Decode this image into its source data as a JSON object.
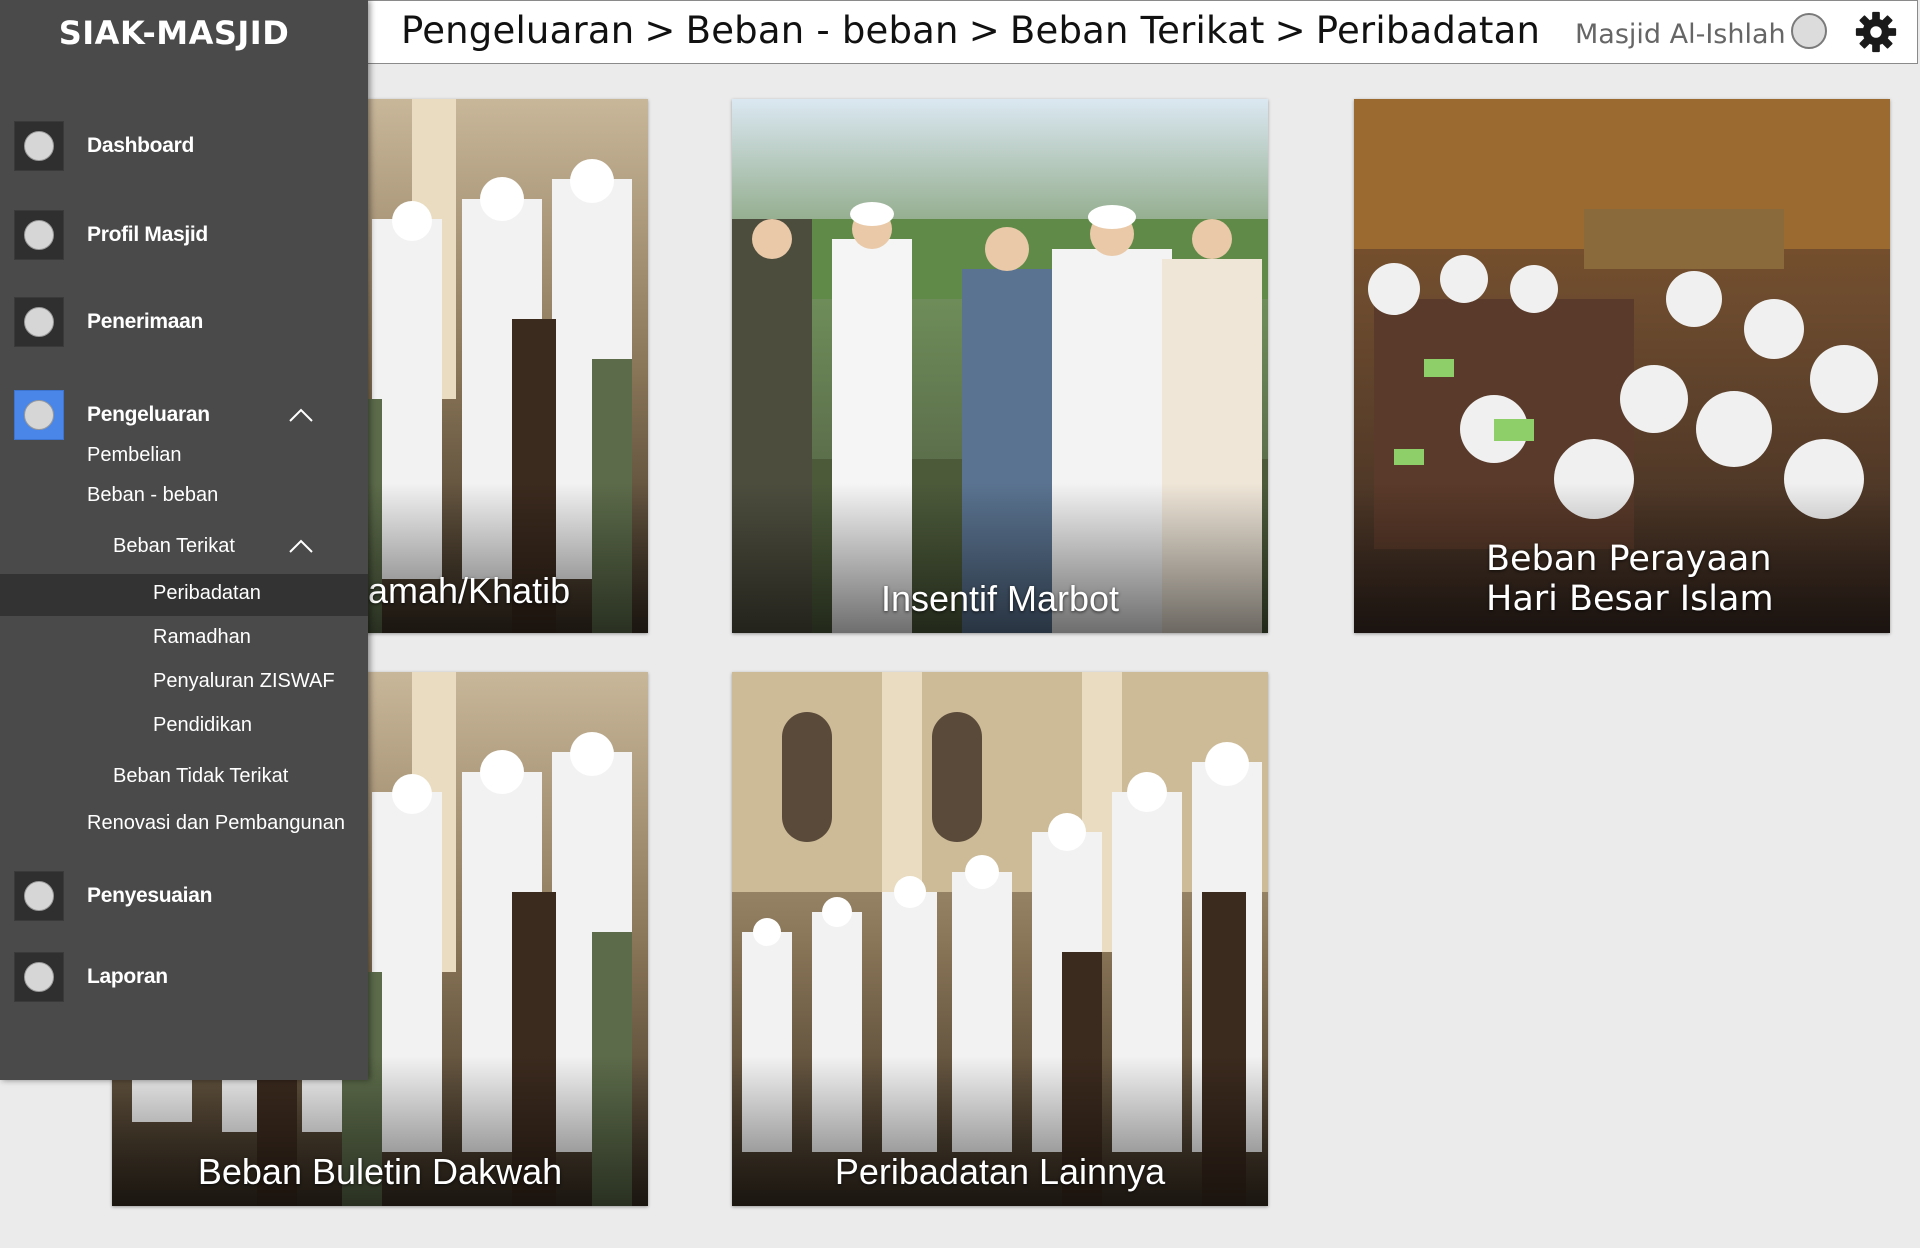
{
  "app": {
    "title": "SIAK-MASJID"
  },
  "header": {
    "breadcrumb": [
      "Pengeluaran",
      "Beban - beban",
      "Beban Terikat",
      "Peribadatan"
    ],
    "separator": ">",
    "mosque_name": "Masjid Al-Ishlah",
    "avatar_icon": "user-avatar-icon",
    "settings_icon": "gear-icon"
  },
  "sidebar": {
    "items": [
      {
        "label": "Dashboard",
        "icon": "circle-icon"
      },
      {
        "label": "Profil Masjid",
        "icon": "circle-icon"
      },
      {
        "label": "Penerimaan",
        "icon": "circle-icon"
      },
      {
        "label": "Pengeluaran",
        "icon": "circle-icon",
        "active": true,
        "expanded": true
      },
      {
        "label": "Penyesuaian",
        "icon": "circle-icon"
      },
      {
        "label": "Laporan",
        "icon": "circle-icon"
      }
    ],
    "pengeluaran_sub": {
      "pembelian": "Pembelian",
      "beban": "Beban - beban",
      "beban_terikat": "Beban Terikat",
      "beban_terikat_items": [
        "Peribadatan",
        "Ramadhan",
        "Penyaluran ZISWAF",
        "Pendidikan"
      ],
      "beban_tidak_terikat": "Beban Tidak Terikat",
      "renovasi": "Renovasi dan Pembangunan"
    },
    "active_color": "#4a86e8"
  },
  "cards": [
    {
      "title_visible": "amah/Khatib",
      "image": "congregation-prayer-photo"
    },
    {
      "title": "Insentif Marbot",
      "image": "greeting-crowd-photo"
    },
    {
      "title_line1": "Beban Perayaan",
      "title_line2": "Hari Besar Islam",
      "image": "gathering-meal-photo"
    },
    {
      "title": "Beban Buletin Dakwah",
      "image": "congregation-prayer-photo"
    },
    {
      "title": "Peribadatan Lainnya",
      "image": "congregation-prayer-photo"
    }
  ]
}
